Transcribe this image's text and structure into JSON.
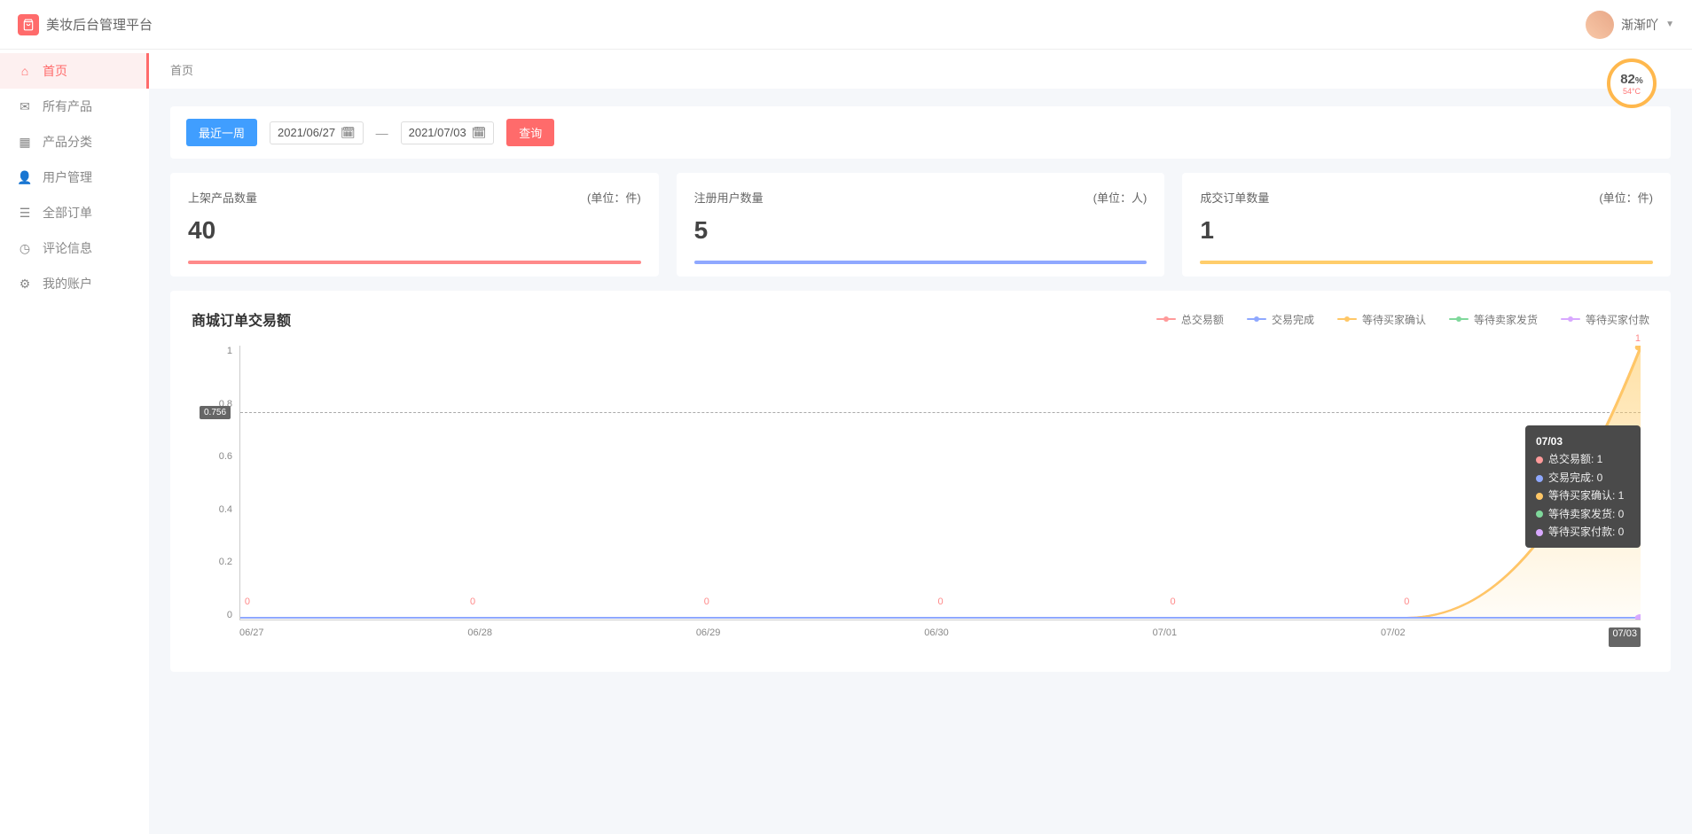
{
  "header": {
    "title": "美妆后台管理平台",
    "username": "渐渐吖"
  },
  "gauge": {
    "percent": "82",
    "pct_suffix": "%",
    "temp": "54°C"
  },
  "sidebar": {
    "items": [
      {
        "label": "首页",
        "icon": "home"
      },
      {
        "label": "所有产品",
        "icon": "mail"
      },
      {
        "label": "产品分类",
        "icon": "grid"
      },
      {
        "label": "用户管理",
        "icon": "user"
      },
      {
        "label": "全部订单",
        "icon": "list"
      },
      {
        "label": "评论信息",
        "icon": "clock"
      },
      {
        "label": "我的账户",
        "icon": "gear"
      }
    ]
  },
  "breadcrumb": "首页",
  "filter": {
    "recent_label": "最近一周",
    "date_from": "2021/06/27",
    "date_to": "2021/07/03",
    "separator": "—",
    "query_label": "查询"
  },
  "stats": [
    {
      "title": "上架产品数量",
      "unit": "(单位：件)",
      "value": "40",
      "bar": "red"
    },
    {
      "title": "注册用户数量",
      "unit": "(单位：人)",
      "value": "5",
      "bar": "blue"
    },
    {
      "title": "成交订单数量",
      "unit": "(单位：件)",
      "value": "1",
      "bar": "orange"
    }
  ],
  "chart_title": "商城订单交易额",
  "legend": [
    {
      "label": "总交易额",
      "color": "pink"
    },
    {
      "label": "交易完成",
      "color": "blue"
    },
    {
      "label": "等待买家确认",
      "color": "orange"
    },
    {
      "label": "等待卖家发货",
      "color": "green"
    },
    {
      "label": "等待买家付款",
      "color": "purple"
    }
  ],
  "chart_data": {
    "type": "line",
    "title": "商城订单交易额",
    "xlabel": "",
    "ylabel": "",
    "ylim": [
      0,
      1
    ],
    "y_ticks": [
      "1",
      "0.8",
      "0.6",
      "0.4",
      "0.2",
      "0"
    ],
    "categories": [
      "06/27",
      "06/28",
      "06/29",
      "06/30",
      "07/01",
      "07/02",
      "07/03"
    ],
    "series": [
      {
        "name": "总交易额",
        "color": "#ff9a9a",
        "values": [
          0,
          0,
          0,
          0,
          0,
          0,
          1
        ]
      },
      {
        "name": "交易完成",
        "color": "#8fa8ff",
        "values": [
          0,
          0,
          0,
          0,
          0,
          0,
          0
        ]
      },
      {
        "name": "等待买家确认",
        "color": "#ffc766",
        "values": [
          0,
          0,
          0,
          0,
          0,
          0,
          1
        ]
      },
      {
        "name": "等待卖家发货",
        "color": "#7fd89b",
        "values": [
          0,
          0,
          0,
          0,
          0,
          0,
          0
        ]
      },
      {
        "name": "等待买家付款",
        "color": "#d8a8ff",
        "values": [
          0,
          0,
          0,
          0,
          0,
          0,
          0
        ]
      }
    ],
    "mark_line_value": 0.756,
    "data_labels_series": 0,
    "highlight_x_index": 6
  },
  "tooltip": {
    "title": "07/03",
    "rows": [
      {
        "color": "#ff9a9a",
        "text": "总交易额: 1"
      },
      {
        "color": "#8fa8ff",
        "text": "交易完成: 0"
      },
      {
        "color": "#ffc766",
        "text": "等待买家确认: 1"
      },
      {
        "color": "#7fd89b",
        "text": "等待卖家发货: 0"
      },
      {
        "color": "#d8a8ff",
        "text": "等待买家付款: 0"
      }
    ]
  }
}
